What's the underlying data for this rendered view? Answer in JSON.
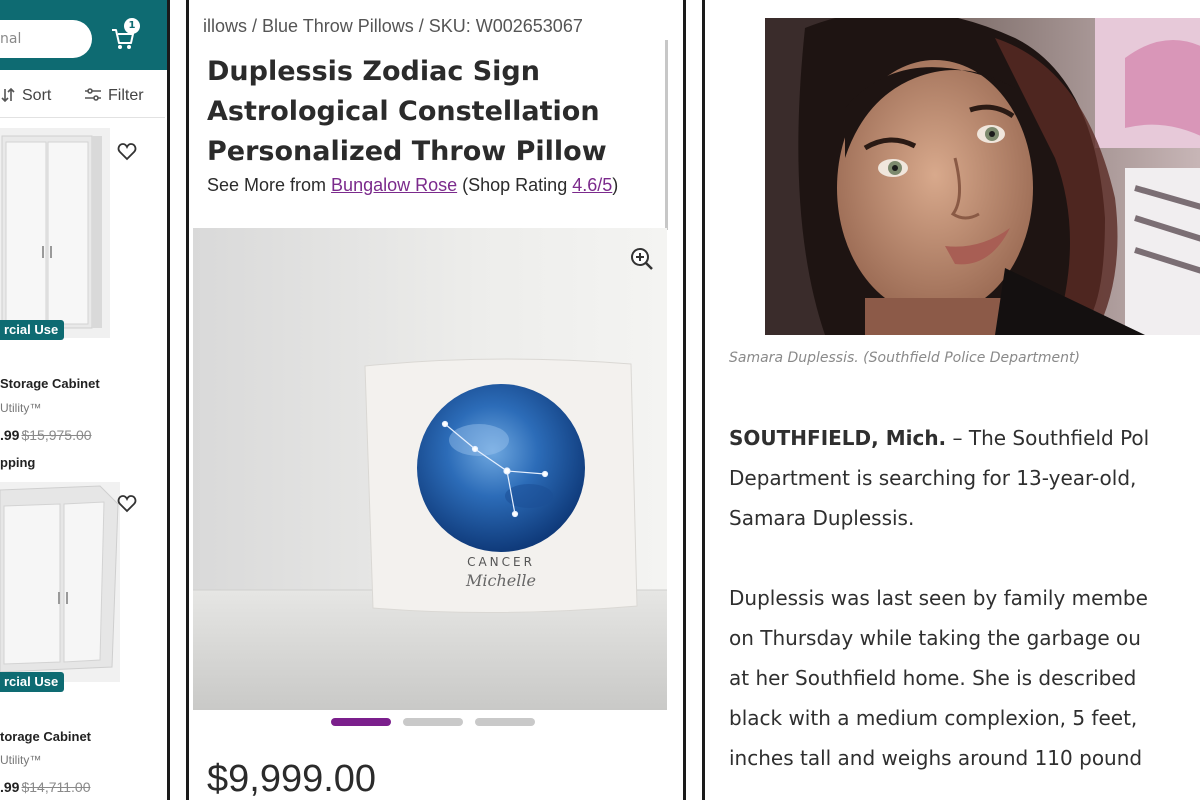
{
  "listing": {
    "search_text": "nal",
    "cart_count": "1",
    "sort_label": "Sort",
    "filter_label": "Filter",
    "items": [
      {
        "badge": "rcial Use",
        "name": "Storage Cabinet",
        "brand": "Utility™",
        "price": ".99",
        "was_price": "$15,975.00",
        "shipping": "pping"
      },
      {
        "badge": "rcial Use",
        "name": "torage Cabinet",
        "brand": "Utility™",
        "price": ".99",
        "was_price": "$14,711.00"
      }
    ]
  },
  "product": {
    "breadcrumb": "illows  /  Blue Throw Pillows  /  SKU: W002653067",
    "title": "Duplessis Zodiac Sign Astrological Constellation Personalized Throw Pillow",
    "see_more_prefix": "See More from ",
    "brand_link": "Bungalow Rose",
    "rating_prefix": " (Shop Rating ",
    "rating": "4.6/5",
    "rating_suffix": ")",
    "pillow_text_sign": "CANCER",
    "pillow_text_name": "Michelle",
    "carousel": {
      "count": 3,
      "active_index": 0
    },
    "price": "$9,999.00",
    "accent_color": "#7b1f8c"
  },
  "article": {
    "caption": "Samara Duplessis. (Southfield Police Department)",
    "dateline": "SOUTHFIELD, Mich.",
    "p1_lines": [
      " – The Southfield Pol",
      "Department is searching for 13-year-old,",
      "Samara Duplessis."
    ],
    "p2_lines": [
      "Duplessis was last seen by family membe",
      "on Thursday while taking the garbage ou",
      "at her Southfield home. She is described",
      "black with a medium complexion, 5 feet,",
      "inches tall and weighs around 110 pound"
    ]
  },
  "colors": {
    "listing_header": "#0e6b72",
    "link_purple": "#7b2a8c"
  }
}
